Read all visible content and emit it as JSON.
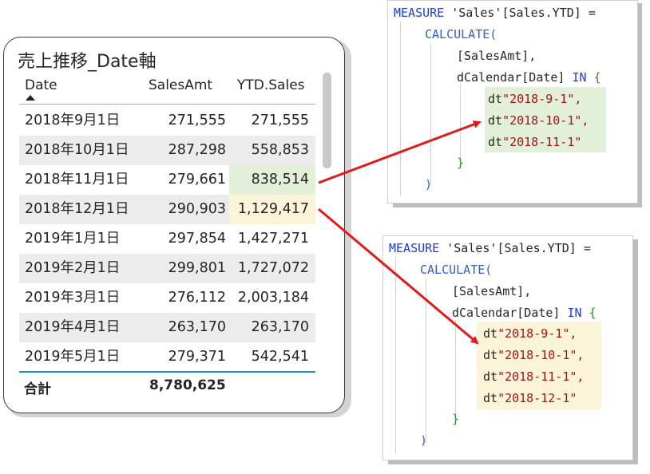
{
  "visual": {
    "title": "売上推移_Date軸",
    "columns": [
      "Date",
      "SalesAmt",
      "YTD.Sales"
    ],
    "rows": [
      {
        "date": "2018年9月1日",
        "amt": "271,555",
        "ytd": "271,555"
      },
      {
        "date": "2018年10月1日",
        "amt": "287,298",
        "ytd": "558,853"
      },
      {
        "date": "2018年11月1日",
        "amt": "279,661",
        "ytd": "838,514"
      },
      {
        "date": "2018年12月1日",
        "amt": "290,903",
        "ytd": "1,129,417"
      },
      {
        "date": "2019年1月1日",
        "amt": "297,854",
        "ytd": "1,427,271"
      },
      {
        "date": "2019年2月1日",
        "amt": "299,801",
        "ytd": "1,727,072"
      },
      {
        "date": "2019年3月1日",
        "amt": "276,112",
        "ytd": "2,003,184"
      },
      {
        "date": "2019年4月1日",
        "amt": "263,170",
        "ytd": "263,170"
      },
      {
        "date": "2019年5月1日",
        "amt": "279,371",
        "ytd": "542,541"
      }
    ],
    "total_label": "合計",
    "total_value": "8,780,625"
  },
  "code1": {
    "line1_kw": "MEASURE",
    "line1_txt": " 'Sales'[Sales.YTD] =",
    "line2": "CALCULATE(",
    "line3": "[SalesAmt],",
    "line4_a": "dCalendar[Date] ",
    "line4_kw": "IN",
    "line4_brace": " {",
    "dates": [
      "\"2018-9-1\",",
      "\"2018-10-1\",",
      "\"2018-11-1\""
    ],
    "dt": "dt",
    "close_brace": "}",
    "close_paren": ")"
  },
  "code2": {
    "line1_kw": "MEASURE",
    "line1_txt": " 'Sales'[Sales.YTD] =",
    "line2": "CALCULATE(",
    "line3": "[SalesAmt],",
    "line4_a": "dCalendar[Date] ",
    "line4_kw": "IN",
    "line4_brace": " {",
    "dates": [
      "\"2018-9-1\",",
      "\"2018-10-1\",",
      "\"2018-11-1\",",
      "\"2018-12-1\""
    ],
    "dt": "dt",
    "close_brace": "}",
    "close_paren": ")"
  },
  "colors": {
    "arrow": "#e01b1b",
    "highlight_green": "#e2f0d9",
    "highlight_yellow": "#fcf4d8"
  }
}
